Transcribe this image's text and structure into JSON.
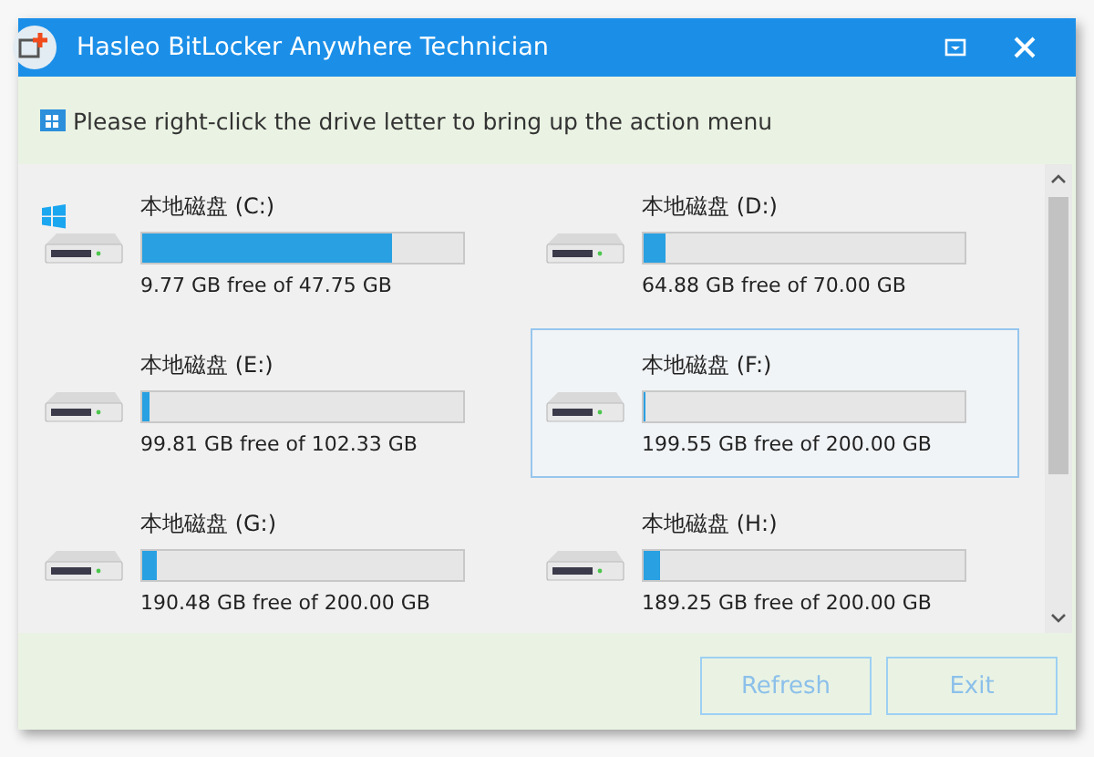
{
  "window": {
    "title": "Hasleo BitLocker Anywhere Technician"
  },
  "hint": "Please right-click the drive letter to bring up the action menu",
  "drives": [
    {
      "name": "本地磁盘 (C:)",
      "free": "9.77 GB free of 47.75 GB",
      "level": 0.78,
      "system": true,
      "selected": false
    },
    {
      "name": "本地磁盘 (D:)",
      "free": "64.88 GB free of 70.00 GB",
      "level": 0.07,
      "system": false,
      "selected": false
    },
    {
      "name": "本地磁盘 (E:)",
      "free": "99.81 GB free of 102.33 GB",
      "level": 0.025,
      "system": false,
      "selected": false
    },
    {
      "name": "本地磁盘 (F:)",
      "free": "199.55 GB free of 200.00 GB",
      "level": 0.005,
      "system": false,
      "selected": true
    },
    {
      "name": "本地磁盘 (G:)",
      "free": "190.48 GB free of 200.00 GB",
      "level": 0.045,
      "system": false,
      "selected": false
    },
    {
      "name": "本地磁盘 (H:)",
      "free": "189.25 GB free of 200.00 GB",
      "level": 0.05,
      "system": false,
      "selected": false
    }
  ],
  "buttons": [
    {
      "label": "Refresh",
      "disabled": true
    },
    {
      "label": "Exit",
      "disabled": true
    }
  ]
}
